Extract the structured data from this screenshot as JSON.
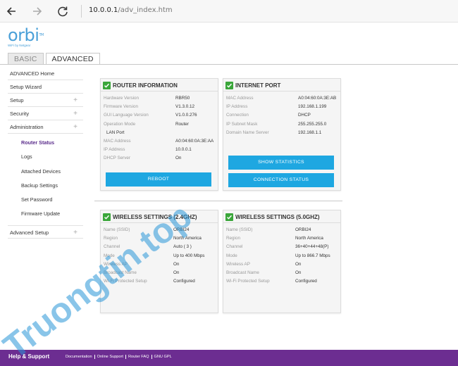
{
  "browser": {
    "url_host": "10.0.0.1",
    "url_path": "/adv_index.htm"
  },
  "logo": {
    "text": "orbi",
    "tagline": "WiFi by Netgear"
  },
  "tabs": [
    {
      "label": "BASIC"
    },
    {
      "label": "ADVANCED"
    }
  ],
  "sidebar": {
    "items": [
      {
        "label": "ADVANCED Home",
        "expandable": false
      },
      {
        "label": "Setup Wizard",
        "expandable": false
      },
      {
        "label": "Setup",
        "expandable": true
      },
      {
        "label": "Security",
        "expandable": true
      },
      {
        "label": "Administration",
        "expandable": true
      }
    ],
    "subitems": [
      {
        "label": "Router Status",
        "active": true
      },
      {
        "label": "Logs"
      },
      {
        "label": "Attached Devices"
      },
      {
        "label": "Backup Settings"
      },
      {
        "label": "Set Password"
      },
      {
        "label": "Firmware Update"
      }
    ],
    "advanced_setup": "Advanced Setup"
  },
  "router_info": {
    "title": "ROUTER INFORMATION",
    "rows": [
      [
        "Hardware Version",
        "RBR50"
      ],
      [
        "Firmware Version",
        "V1.3.0.12"
      ],
      [
        "GUI Language Version",
        "V1.0.0.276"
      ],
      [
        "Operation Mode",
        "Router"
      ],
      [
        "LAN Port",
        ""
      ],
      [
        "MAC Address",
        "A0:04:60:0A:3E:AA"
      ],
      [
        "IP Address",
        "10.0.0.1"
      ],
      [
        "DHCP Server",
        "On"
      ]
    ],
    "button": "REBOOT"
  },
  "internet_port": {
    "title": "INTERNET PORT",
    "rows": [
      [
        "MAC Address",
        "A0:04:60:0A:3E:AB"
      ],
      [
        "IP Address",
        "192.168.1.199"
      ],
      [
        "Connection",
        "DHCP"
      ],
      [
        "IP Subnet Mask",
        "255.255.255.0"
      ],
      [
        "Domain Name Server",
        "192.168.1.1"
      ]
    ],
    "button1": "SHOW STATISTICS",
    "button2": "CONNECTION STATUS"
  },
  "wireless_24": {
    "title": "WIRELESS SETTINGS (2.4GHZ)",
    "rows": [
      [
        "Name (SSID)",
        "ORBI24"
      ],
      [
        "Region",
        "North America"
      ],
      [
        "Channel",
        "Auto ( 3 )"
      ],
      [
        "Mode",
        "Up to 400 Mbps"
      ],
      [
        "Wireless AP",
        "On"
      ],
      [
        "Broadcast Name",
        "On"
      ],
      [
        "Wi-Fi Protected Setup",
        "Configured"
      ]
    ]
  },
  "wireless_50": {
    "title": "WIRELESS SETTINGS (5.0GHZ)",
    "rows": [
      [
        "Name (SSID)",
        "ORBI24"
      ],
      [
        "Region",
        "North America"
      ],
      [
        "Channel",
        "36+40+44+48(P)"
      ],
      [
        "Mode",
        "Up to 866.7 Mbps"
      ],
      [
        "Wireless AP",
        "On"
      ],
      [
        "Broadcast Name",
        "On"
      ],
      [
        "Wi-Fi Protected Setup",
        "Configured"
      ]
    ]
  },
  "footer": {
    "help": "Help & Support",
    "links": [
      "Documentation",
      "Online Support",
      "Router FAQ",
      "GNU GPL"
    ]
  },
  "watermark": {
    "text": "Truongtin.top"
  },
  "colors": {
    "accent_blue": "#1ea7e1",
    "footer_purple": "#6c2d91",
    "check_green": "#3aa63a",
    "active_link": "#5b2d8c",
    "logo_blue": "#4aa0d8"
  }
}
